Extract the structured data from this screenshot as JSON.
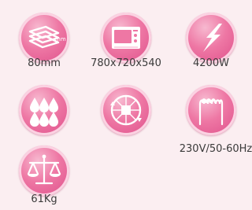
{
  "colors": {
    "badge": "#e25b93",
    "badge_light": "#f7b9d0",
    "background": "#fbeef1",
    "icon": "#ffffff"
  },
  "features": [
    {
      "icon": "layered-sheets-icon",
      "value": "80mm",
      "icon_text": "mm"
    },
    {
      "icon": "oven-icon",
      "value": "780x720x540"
    },
    {
      "icon": "power-lightning-icon",
      "value": "4200W"
    },
    {
      "icon": "water-drops-icon",
      "value": ""
    },
    {
      "icon": "convection-fan-icon",
      "value": ""
    },
    {
      "icon": "heating-coil-icon",
      "value": "230V/50-60Hz"
    },
    {
      "icon": "scale-icon",
      "value": "61Kg"
    }
  ]
}
